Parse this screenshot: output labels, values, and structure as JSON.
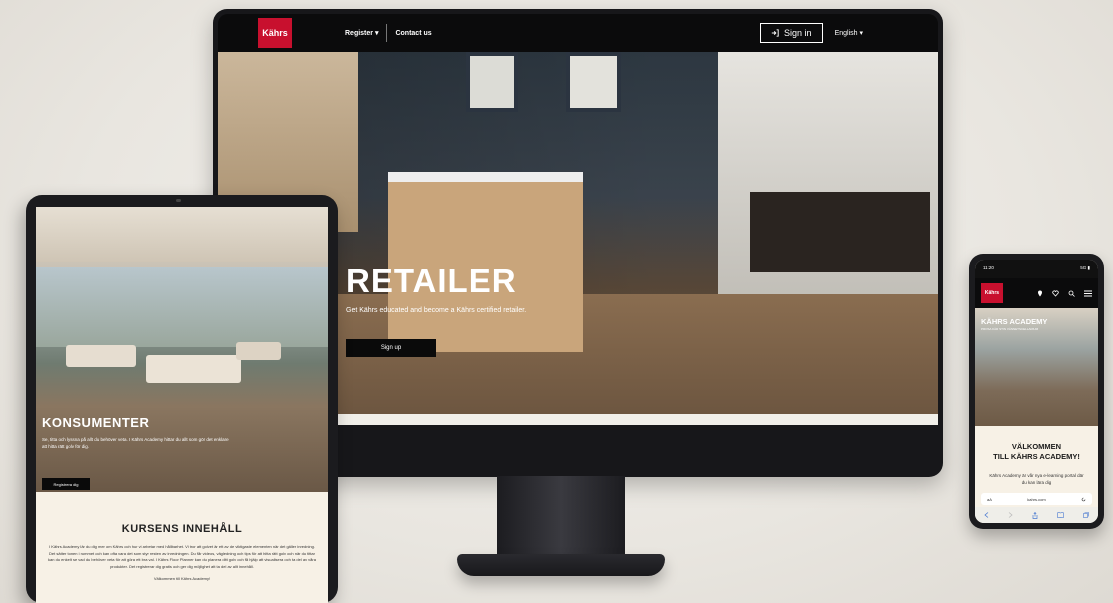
{
  "desktop": {
    "nav": {
      "logo": "Kährs",
      "register": "Register ▾",
      "contact": "Contact us",
      "sign_in": "Sign in",
      "sign_in_icon": "login-arrow-icon",
      "language": "English ▾"
    },
    "hero": {
      "title": "RETAILER",
      "subtitle": "Get Kährs educated and become a Kährs certified retailer.",
      "button": "Sign up"
    }
  },
  "tablet": {
    "hero": {
      "title": "KONSUMENTER",
      "subtitle": "Se, titta och lyssna på allt du behöver veta. I Kährs Academy hittar du allt som gör det enklare att hitta rätt golv för dig.",
      "button": "Registrera dig"
    },
    "content": {
      "title": "KURSENS INNEHÅLL",
      "body": "I Kährs Academy lär du dig mer om Kährs och hur vi arbetar med hållbarhet. Vi tror att golvet är ett av de viktigaste elementen när det gäller inredning. Det sätter tonen i rummet och kan ofta vara det som styr resten av inredningen. Du får videos, vägledning och tips för att hitta rätt golv och när du tittar kan du enkelt se vad du behöver veta för att göra ett bra val. I Kährs Floor Planner kan du planera ditt golv och få hjälp att visualisera och ta del av våra produkter. Det registrerar dig gratis och ger dig möjlighet att ta del av allt innehåll.",
      "ending": "Välkommen till Kährs Academy!"
    }
  },
  "phone": {
    "status_time": "11:20",
    "status_right": "5G ▮",
    "nav": {
      "logo": "Kährs",
      "icons": [
        "pin-icon",
        "heart-icon",
        "search-icon",
        "menu-icon"
      ]
    },
    "hero": {
      "title": "KÄHRS ACADEMY",
      "subtitle": "PROSA KÄR STIN VÄNNETSCELLARIUM"
    },
    "welcome": {
      "title_line1": "VÄLKOMMEN",
      "title_line2": "TILL KÄHRS ACADEMY!",
      "body": "Kährs Academy är vår nya e-learning portal där du kan lära dig"
    },
    "url": {
      "left": "aA",
      "domain": "kahrs.com"
    }
  }
}
